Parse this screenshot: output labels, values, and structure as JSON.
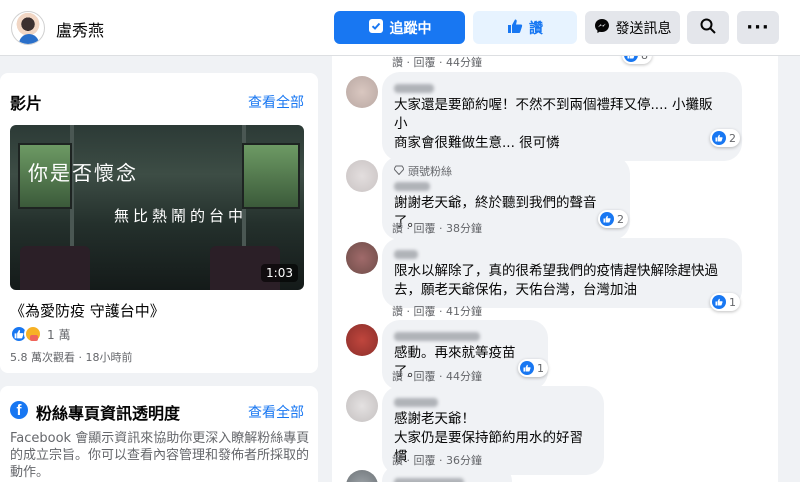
{
  "header": {
    "page_name": "盧秀燕",
    "follow_label": "追蹤中",
    "like_label": "讚",
    "message_label": "發送訊息",
    "more_label": "···"
  },
  "videos": {
    "title": "影片",
    "see_all": "查看全部",
    "overlay_line1": "你是否懷念",
    "overlay_line2": "無比熱鬧的台中",
    "duration": "1:03",
    "video_title": "《為愛防疫 守護台中》",
    "reaction_count": "1 萬",
    "meta": "5.8 萬次觀看 · 18小時前"
  },
  "transparency": {
    "title": "粉絲專頁資訊透明度",
    "see_all": "查看全部",
    "description": "Facebook 會顯示資訊來協助你更深入瞭解粉絲專頁的成立宗旨。你可以查看內容管理和發佈者所採取的動作。"
  },
  "comments": [
    {
      "actions": "讚 · 回覆 · 44分鐘",
      "reaction_count": "8"
    },
    {
      "text_lines": [
        "大家還是要節約喔！不然不到兩個禮拜又停.... 小攤販 小",
        "商家會很難做生意... 很可憐"
      ],
      "reaction_count": "2"
    },
    {
      "badge": "頭號粉絲",
      "text_lines": [
        "謝謝老天爺，終於聽到我們的聲音了。"
      ],
      "reaction_count": "2",
      "actions": "讚 · 回覆 · 38分鐘"
    },
    {
      "text_lines": [
        "限水以解除了，真的很希望我們的疫情趕快解除趕快過",
        "去，願老天爺保佑，天佑台灣，台灣加油"
      ],
      "reaction_count": "1",
      "actions": "讚 · 回覆 · 41分鐘"
    },
    {
      "text_lines": [
        "感動。再來就等疫苗了。"
      ],
      "reaction_count": "1",
      "actions": "讚 · 回覆 · 44分鐘"
    },
    {
      "text_lines": [
        "感謝老天爺！",
        "大家仍是要保持節約用水的好習慣"
      ],
      "actions": "讚 · 回覆 · 36分鐘"
    }
  ],
  "colors": {
    "brand_blue": "#1877f2",
    "bubble_bg": "#f0f2f5",
    "page_bg": "#f0f2f5",
    "muted_text": "#65676b"
  },
  "icons": [
    "follow-check-icon",
    "thumbs-up-icon",
    "messenger-icon",
    "search-icon",
    "more-icon",
    "facebook-icon",
    "gem-icon"
  ]
}
